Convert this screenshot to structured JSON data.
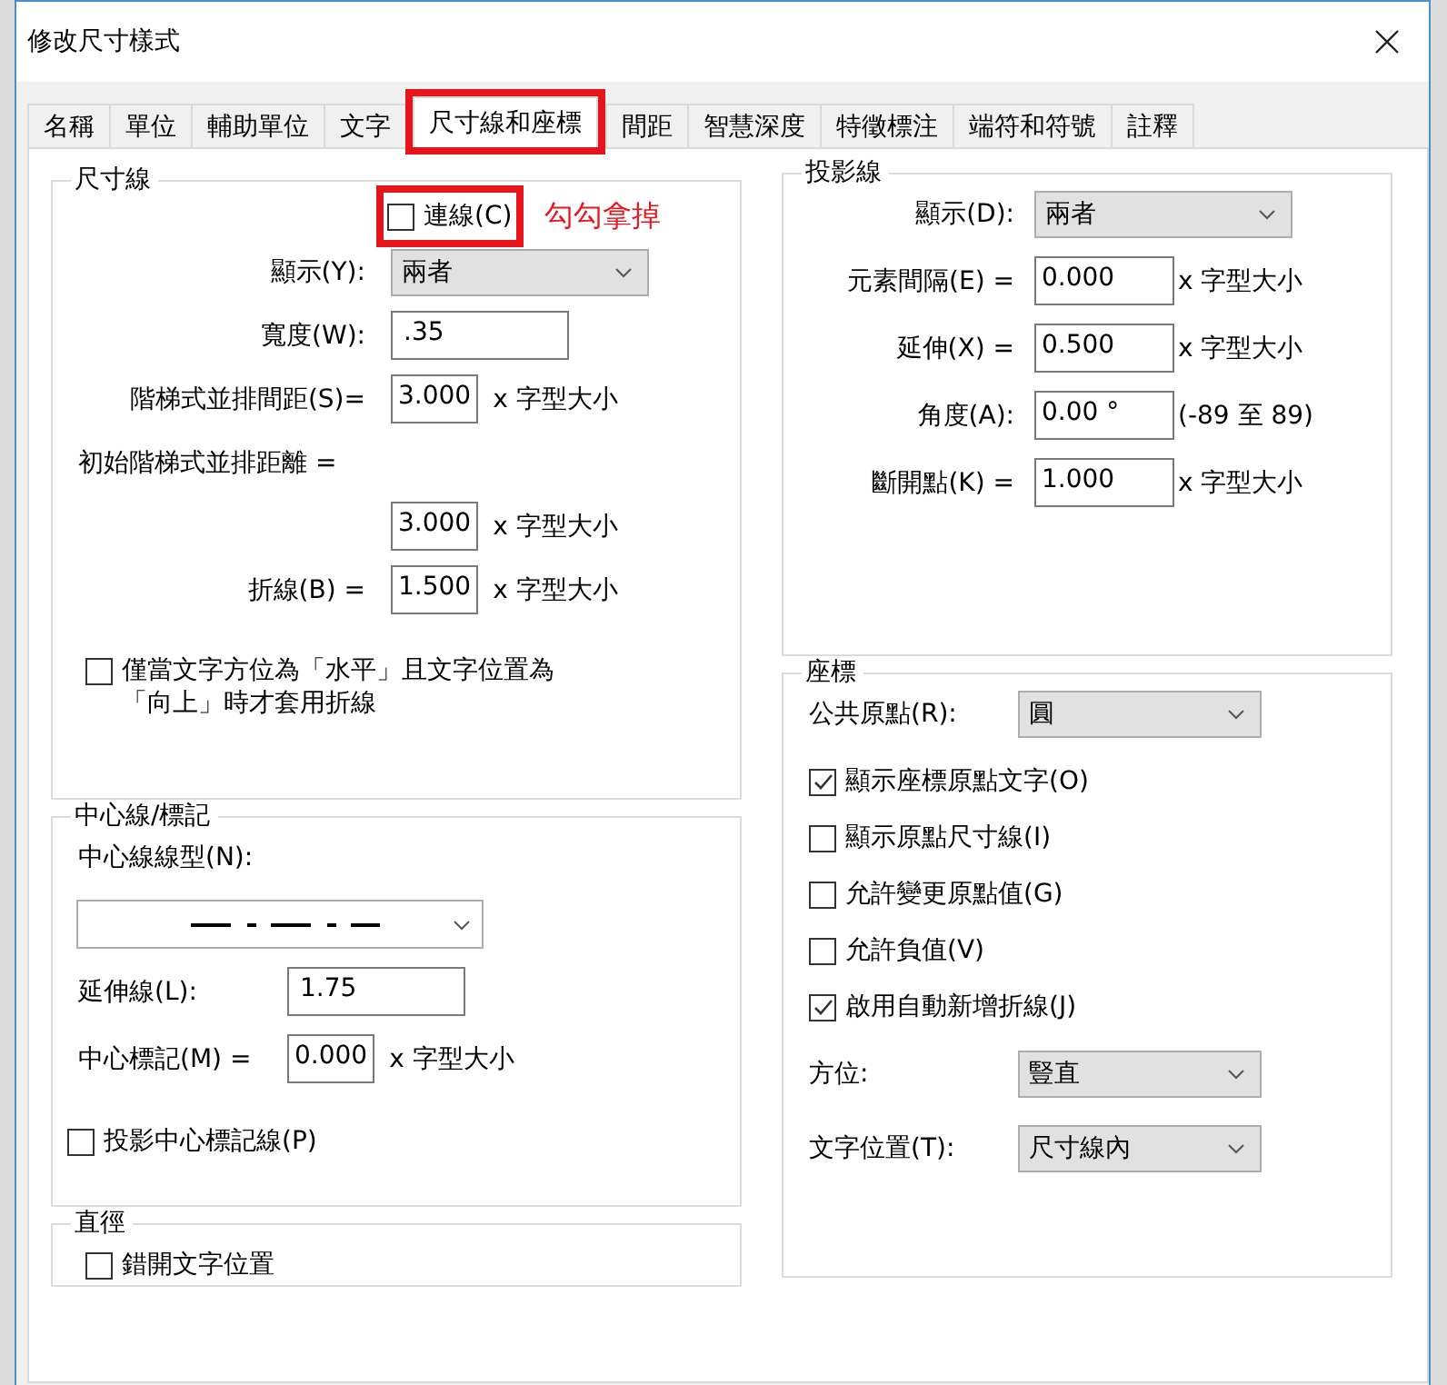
{
  "window": {
    "title": "修改尺寸樣式"
  },
  "tabs": [
    {
      "label": "名稱",
      "selected": false,
      "annotated": false
    },
    {
      "label": "單位",
      "selected": false,
      "annotated": false
    },
    {
      "label": "輔助單位",
      "selected": false,
      "annotated": false
    },
    {
      "label": "文字",
      "selected": false,
      "annotated": false
    },
    {
      "label": "尺寸線和座標",
      "selected": true,
      "annotated": true
    },
    {
      "label": "間距",
      "selected": false,
      "annotated": false
    },
    {
      "label": "智慧深度",
      "selected": false,
      "annotated": false
    },
    {
      "label": "特徵標注",
      "selected": false,
      "annotated": false
    },
    {
      "label": "端符和符號",
      "selected": false,
      "annotated": false
    },
    {
      "label": "註釋",
      "selected": false,
      "annotated": false
    }
  ],
  "left_column": [
    {
      "title": "尺寸線",
      "rows": [
        {
          "kind": "checkbox",
          "label": "連線(C)",
          "checked": false,
          "annotated": true,
          "note": "勾勾拿掉"
        },
        {
          "kind": "dropdown",
          "label": "顯示(Y):",
          "value": "兩者"
        },
        {
          "kind": "field",
          "label": "寬度(W):",
          "value": ".35"
        },
        {
          "kind": "measure",
          "label": "階梯式並排間距(S)=",
          "value": "3.000",
          "unit": "x 字型大小"
        },
        {
          "kind": "label",
          "label": "初始階梯式並排距離 ="
        },
        {
          "kind": "measure",
          "value": "3.000",
          "unit": "x 字型大小"
        },
        {
          "kind": "measure",
          "label": "折線(B) =",
          "value": "1.500",
          "unit": "x 字型大小"
        },
        {
          "kind": "checkbox",
          "label": "僅當文字方位為「水平」且文字位置為「向上」時才套用折線",
          "checked": false,
          "annotated": false
        }
      ]
    },
    {
      "title": "中心線/標記",
      "rows": [
        {
          "kind": "label",
          "label": "中心線線型(N):"
        },
        {
          "kind": "linetype"
        },
        {
          "kind": "field",
          "label": "延伸線(L):",
          "value": "1.75"
        },
        {
          "kind": "measure",
          "label": "中心標記(M) =",
          "value": "0.000",
          "unit": "x 字型大小"
        },
        {
          "kind": "checkbox",
          "label": "投影中心標記線(P)",
          "checked": false,
          "annotated": false
        }
      ]
    },
    {
      "title": "直徑",
      "rows": [
        {
          "kind": "checkbox",
          "label": "錯開文字位置",
          "checked": false,
          "annotated": false
        }
      ]
    }
  ],
  "right_column": [
    {
      "title": "投影線",
      "rows": [
        {
          "kind": "dropdown",
          "label": "顯示(D):",
          "value": "兩者"
        },
        {
          "kind": "measure",
          "label": "元素間隔(E) =",
          "value": "0.000",
          "unit": "x 字型大小"
        },
        {
          "kind": "measure",
          "label": "延伸(X) =",
          "value": "0.500",
          "unit": "x 字型大小"
        },
        {
          "kind": "measure",
          "label": "角度(A):",
          "value": "0.00 °",
          "unit": "(-89 至 89)"
        },
        {
          "kind": "measure",
          "label": "斷開點(K) =",
          "value": "1.000",
          "unit": "x 字型大小"
        }
      ]
    },
    {
      "title": "座標",
      "rows": [
        {
          "kind": "dropdown",
          "label": "公共原點(R):",
          "value": "圓"
        },
        {
          "kind": "checkbox",
          "label": "顯示座標原點文字(O)",
          "checked": true,
          "annotated": false
        },
        {
          "kind": "checkbox",
          "label": "顯示原點尺寸線(I)",
          "checked": false,
          "annotated": false
        },
        {
          "kind": "checkbox",
          "label": "允許變更原點值(G)",
          "checked": false,
          "annotated": false
        },
        {
          "kind": "checkbox",
          "label": "允許負值(V)",
          "checked": false,
          "annotated": false
        },
        {
          "kind": "checkbox",
          "label": "啟用自動新增折線(J)",
          "checked": true,
          "annotated": false
        },
        {
          "kind": "dropdown",
          "label": "方位:",
          "value": "豎直"
        },
        {
          "kind": "dropdown",
          "label": "文字位置(T):",
          "value": "尺寸線內"
        }
      ]
    }
  ]
}
